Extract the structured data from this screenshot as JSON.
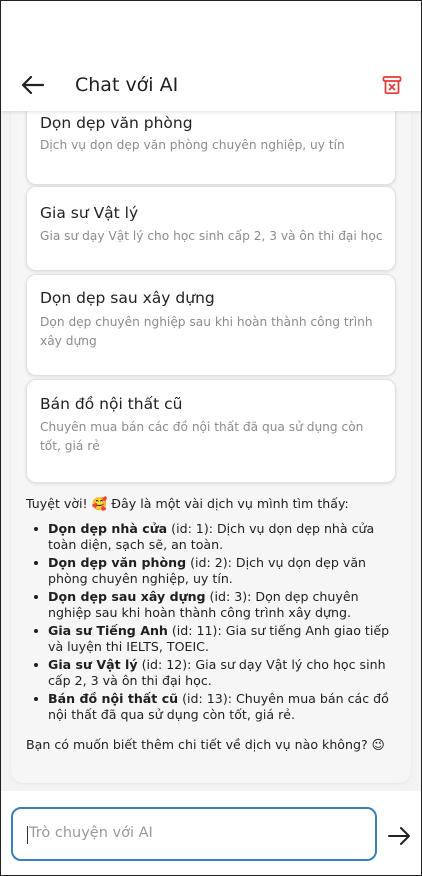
{
  "header": {
    "title": "Chat với AI",
    "back_icon": "arrow-left-icon",
    "delete_icon": "delete-box-icon",
    "accent_color": "#e53935"
  },
  "cards": [
    {
      "title": "Dọn dẹp văn phòng",
      "description": "Dịch vụ dọn dẹp văn phòng chuyên nghiệp, uy tín"
    },
    {
      "title": "Gia sư Vật lý",
      "description": "Gia sư dạy Vật lý cho học sinh cấp 2, 3 và ôn thi đại học"
    },
    {
      "title": "Dọn dẹp sau xây dựng",
      "description": "Dọn dẹp chuyên nghiệp sau khi hoàn thành công trình xây dựng"
    },
    {
      "title": "Bán đồ nội thất cũ",
      "description": "Chuyên mua bán các đồ nội thất đã qua sử dụng còn tốt, giá rẻ"
    }
  ],
  "reply": {
    "intro": "Tuyệt vời! 🥰 Đây là một vài dịch vụ mình tìm thấy:",
    "items": [
      {
        "name": "Dọn dẹp nhà cửa",
        "rest": " (id: 1): Dịch vụ dọn dẹp nhà cửa toàn diện, sạch sẽ, an toàn."
      },
      {
        "name": "Dọn dẹp văn phòng",
        "rest": " (id: 2): Dịch vụ dọn dẹp văn phòng chuyên nghiệp, uy tín."
      },
      {
        "name": "Dọn dẹp sau xây dựng",
        "rest": " (id: 3): Dọn dẹp chuyên nghiệp sau khi hoàn thành công trình xây dựng."
      },
      {
        "name": "Gia sư Tiếng Anh",
        "rest": " (id: 11): Gia sư tiếng Anh giao tiếp và luyện thi IELTS, TOEIC."
      },
      {
        "name": "Gia sư Vật lý",
        "rest": " (id: 12): Gia sư dạy Vật lý cho học sinh cấp 2, 3 và ôn thi đại học."
      },
      {
        "name": "Bán đồ nội thất cũ",
        "rest": " (id: 13): Chuyên mua bán các đồ nội thất đã qua sử dụng còn tốt, giá rẻ."
      }
    ],
    "outro": "Bạn có muốn biết thêm chi tiết về dịch vụ nào không? 😉"
  },
  "input": {
    "placeholder": "Trò chuyện với AI",
    "send_icon": "arrow-right-icon",
    "border_color": "#3b7fb9"
  }
}
